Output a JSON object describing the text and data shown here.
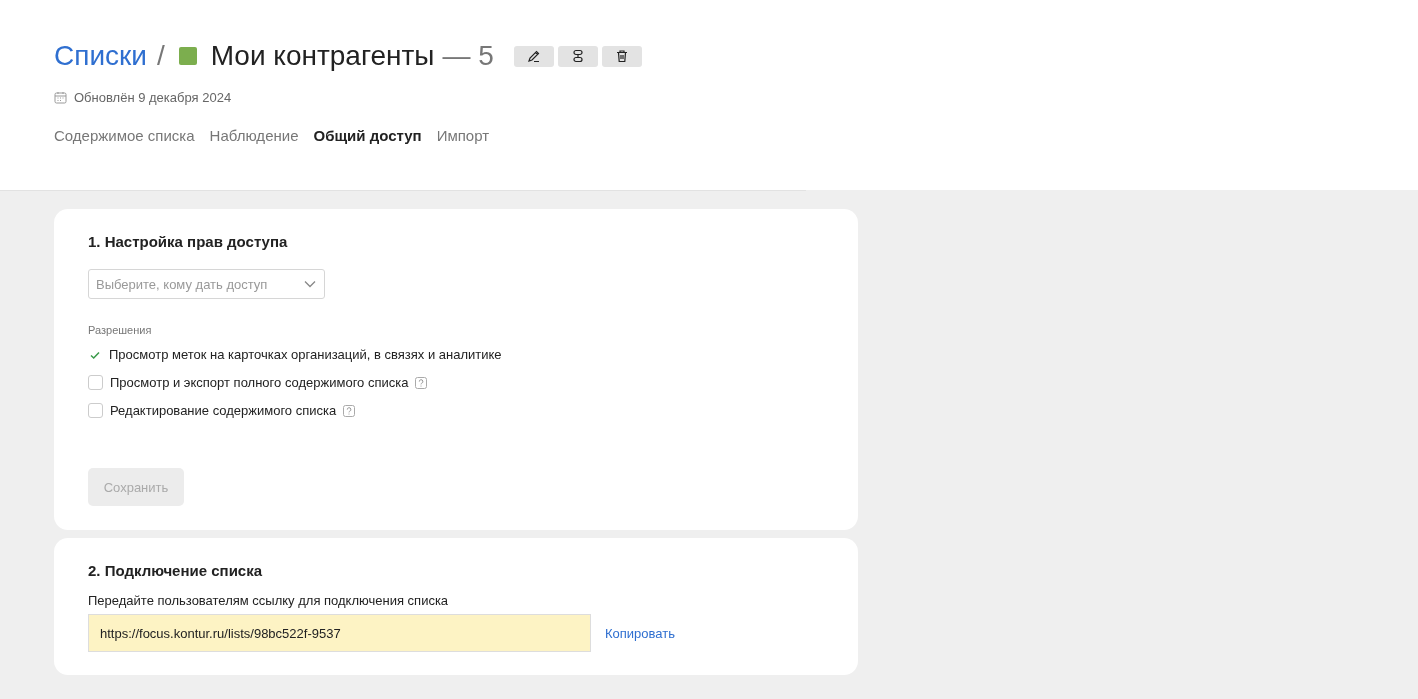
{
  "breadcrumb": {
    "root": "Списки",
    "separator": "/",
    "title": "Мои контрагенты",
    "count": "— 5",
    "color": "#7cae4e"
  },
  "updated": "Обновлён 9 декабря 2024",
  "tabs": [
    {
      "label": "Содержимое списка",
      "selected": false
    },
    {
      "label": "Наблюдение",
      "selected": false
    },
    {
      "label": "Общий доступ",
      "selected": true
    },
    {
      "label": "Импорт",
      "selected": false
    }
  ],
  "access": {
    "title": "1. Настройка прав доступа",
    "select_placeholder": "Выберите, кому дать доступ",
    "permissions_label": "Разрешения",
    "permissions": [
      {
        "label": "Просмотр меток на карточках организаций, в связях и аналитике",
        "checked": true,
        "help": false
      },
      {
        "label": "Просмотр и экспорт полного содержимого списка",
        "checked": false,
        "help": true
      },
      {
        "label": "Редактирование содержимого списка",
        "checked": false,
        "help": true
      }
    ],
    "save_button": {
      "label": "Сохранить",
      "disabled": true
    }
  },
  "connect": {
    "title": "2. Подключение списка",
    "hint": "Передайте пользователям ссылку для подключения списка",
    "link": "https://focus.kontur.ru/lists/98bc522f-9537",
    "copy_label": "Копировать"
  }
}
